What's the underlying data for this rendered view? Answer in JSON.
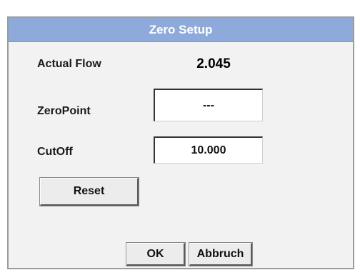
{
  "dialog": {
    "title": "Zero Setup"
  },
  "actual_flow": {
    "label": "Actual Flow",
    "value": "2.045"
  },
  "zero_point": {
    "label": "ZeroPoint",
    "value": "---"
  },
  "cut_off": {
    "label": "CutOff",
    "value": "10.000"
  },
  "buttons": {
    "reset": "Reset",
    "ok": "OK",
    "cancel": "Abbruch"
  }
}
